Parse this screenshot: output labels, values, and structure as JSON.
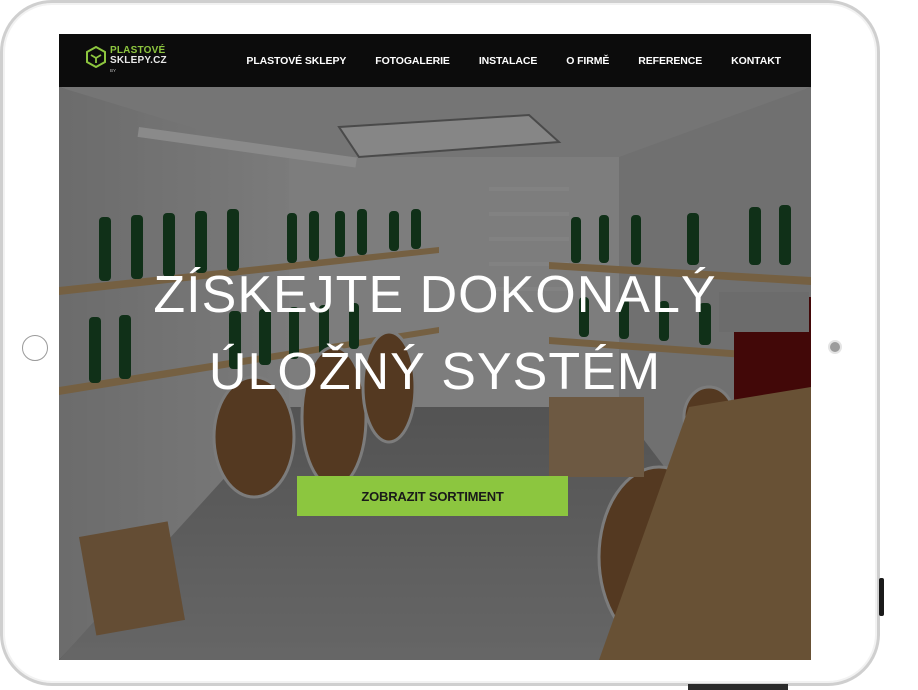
{
  "logo": {
    "line1": "PLASTOVÉ",
    "line2": "SKLEPY.CZ",
    "by": "BY",
    "icon": "hexagon-box-icon"
  },
  "nav": {
    "items": [
      "PLASTOVÉ SKLEPY",
      "FOTOGALERIE",
      "INSTALACE",
      "O FIRMĚ",
      "REFERENCE",
      "KONTAKT"
    ]
  },
  "hero": {
    "headline_line1": "ZÍSKEJTE DOKONALÝ",
    "headline_line2": "ÚLOŽNÝ SYSTÉM",
    "cta_label": "ZOBRAZIT SORTIMENT"
  },
  "colors": {
    "accent": "#8cc63f",
    "navbar": "#0c0c0c",
    "device_frame": "#cfcfcf"
  }
}
